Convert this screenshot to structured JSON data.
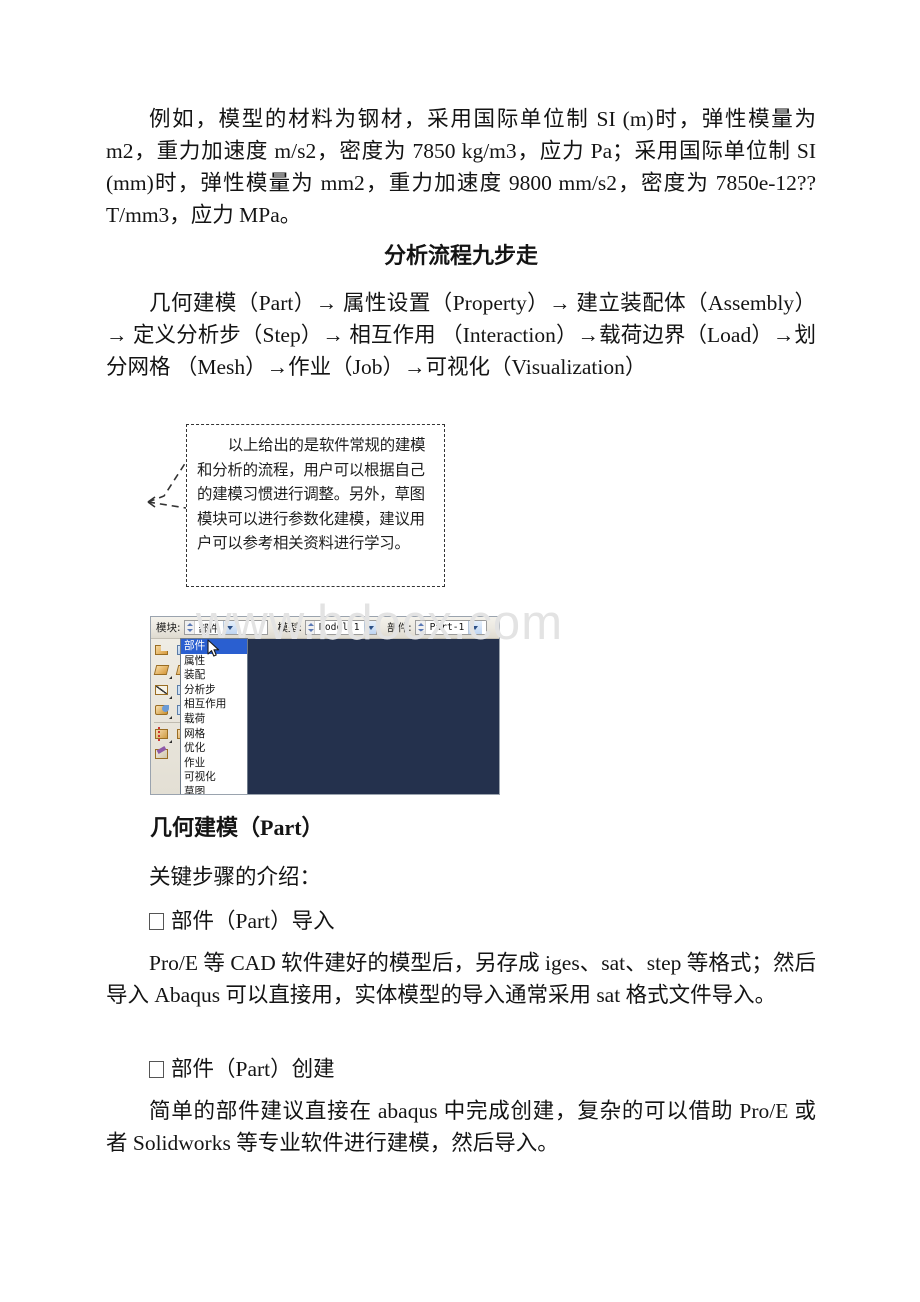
{
  "document": {
    "paragraphs": {
      "units_example": "例如，模型的材料为钢材，采用国际单位制 SI (m)时，弹性模量为 m2，重力加速度 m/s2，密度为 7850 kg/m3，应力 Pa；采用国际单位制 SI (mm)时，弹性模量为 mm2，重力加速度 9800 mm/s2，密度为 7850e-12??T/mm3，应力 MPa。",
      "flow_heading": "分析流程九步走",
      "flow_text": "几何建模（Part）→ 属性设置（Property）→ 建立装配体（Assembly）→ 定义分析步（Step）→ 相互作用 （Interaction）→载荷边界（Load）→划分网格 （Mesh）→作业（Job）→可视化（Visualization）",
      "part_heading": "几何建模（Part）",
      "key_steps_intro": "关键步骤的介绍：",
      "bullet_import": "部件（Part）导入",
      "import_text": "Pro/E 等 CAD 软件建好的模型后，另存成 iges、sat、step 等格式；然后导入 Abaqus 可以直接用，实体模型的导入通常采用 sat 格式文件导入。",
      "bullet_create": "部件（Part）创建",
      "create_text": "简单的部件建议直接在 abaqus 中完成创建，复杂的可以借助 Pro/E 或者 Solidworks 等专业软件进行建模，然后导入。"
    },
    "callout": {
      "text": "以上给出的是软件常规的建模和分析的流程，用户可以根据自己的建模习惯进行调整。另外，草图模块可以进行参数化建模，建议用户可以参考相关资料进行学习。"
    },
    "watermark": "www.bdocx.com"
  },
  "abaqus_screenshot": {
    "toolbar": {
      "module_label": "模块:",
      "module_value": "部件",
      "model_label": "模型:",
      "model_value": "Model-1",
      "part_label": "部件:",
      "part_value": "Part-1"
    },
    "module_dropdown": {
      "selected": "部件",
      "items": [
        "部件",
        "属性",
        "装配",
        "分析步",
        "相互作用",
        "载荷",
        "网格",
        "优化",
        "作业",
        "可视化",
        "草图"
      ]
    },
    "toolbox_icons": [
      "create-part-icon",
      "create-shell-extrude-icon",
      "create-solid-revolve-icon",
      "create-shell-planar-icon",
      "create-wire-icon",
      "create-shell-sweep-icon",
      "create-solid-icon",
      "create-mesh-feature-icon",
      "create-datum-point-icon",
      "translate-instance-icon",
      "create-partition-icon"
    ],
    "colors": {
      "canvas": "#24314d",
      "toolbar": "#ece9e1",
      "selection": "#2a5fd0",
      "selection_text": "#ffffff"
    }
  }
}
